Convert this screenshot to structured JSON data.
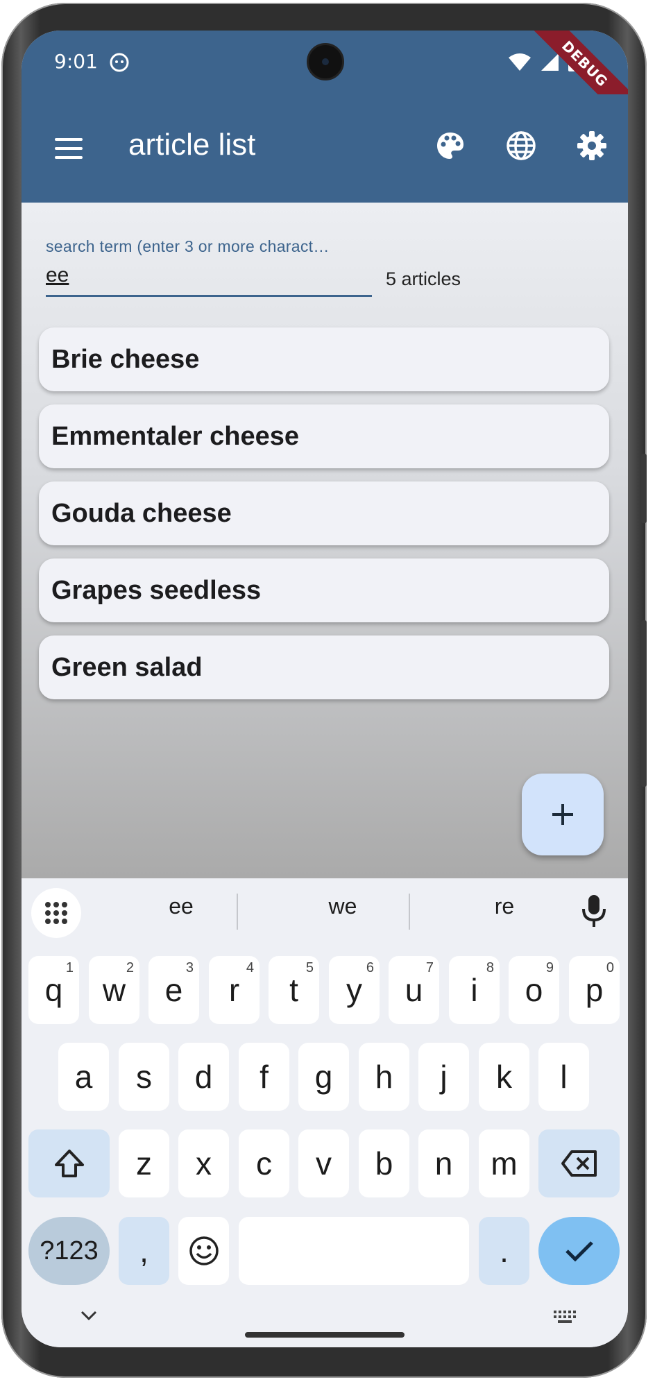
{
  "status_bar": {
    "time": "9:01",
    "debug_banner": "DEBUG"
  },
  "app_bar": {
    "title": "article list",
    "icons": [
      "menu-icon",
      "palette-icon",
      "language-icon",
      "settings-icon"
    ]
  },
  "search": {
    "label": "search term (enter 3 or more charact…",
    "value": "ee",
    "result_count": "5 articles"
  },
  "articles": [
    "Brie cheese",
    "Emmentaler cheese",
    "Gouda cheese",
    "Grapes seedless",
    "Green salad"
  ],
  "fab": {
    "label": "+"
  },
  "keyboard": {
    "suggestions": [
      "ee",
      "we",
      "re"
    ],
    "row1": [
      "q",
      "w",
      "e",
      "r",
      "t",
      "y",
      "u",
      "i",
      "o",
      "p"
    ],
    "row1_hints": [
      "1",
      "2",
      "3",
      "4",
      "5",
      "6",
      "7",
      "8",
      "9",
      "0"
    ],
    "row2": [
      "a",
      "s",
      "d",
      "f",
      "g",
      "h",
      "j",
      "k",
      "l"
    ],
    "row3": [
      "z",
      "x",
      "c",
      "v",
      "b",
      "n",
      "m"
    ],
    "symbols_key": "?123",
    "comma_key": ",",
    "period_key": "."
  },
  "colors": {
    "primary": "#3d648d",
    "fab": "#d2e3fb",
    "debug": "#8b1d2b"
  }
}
